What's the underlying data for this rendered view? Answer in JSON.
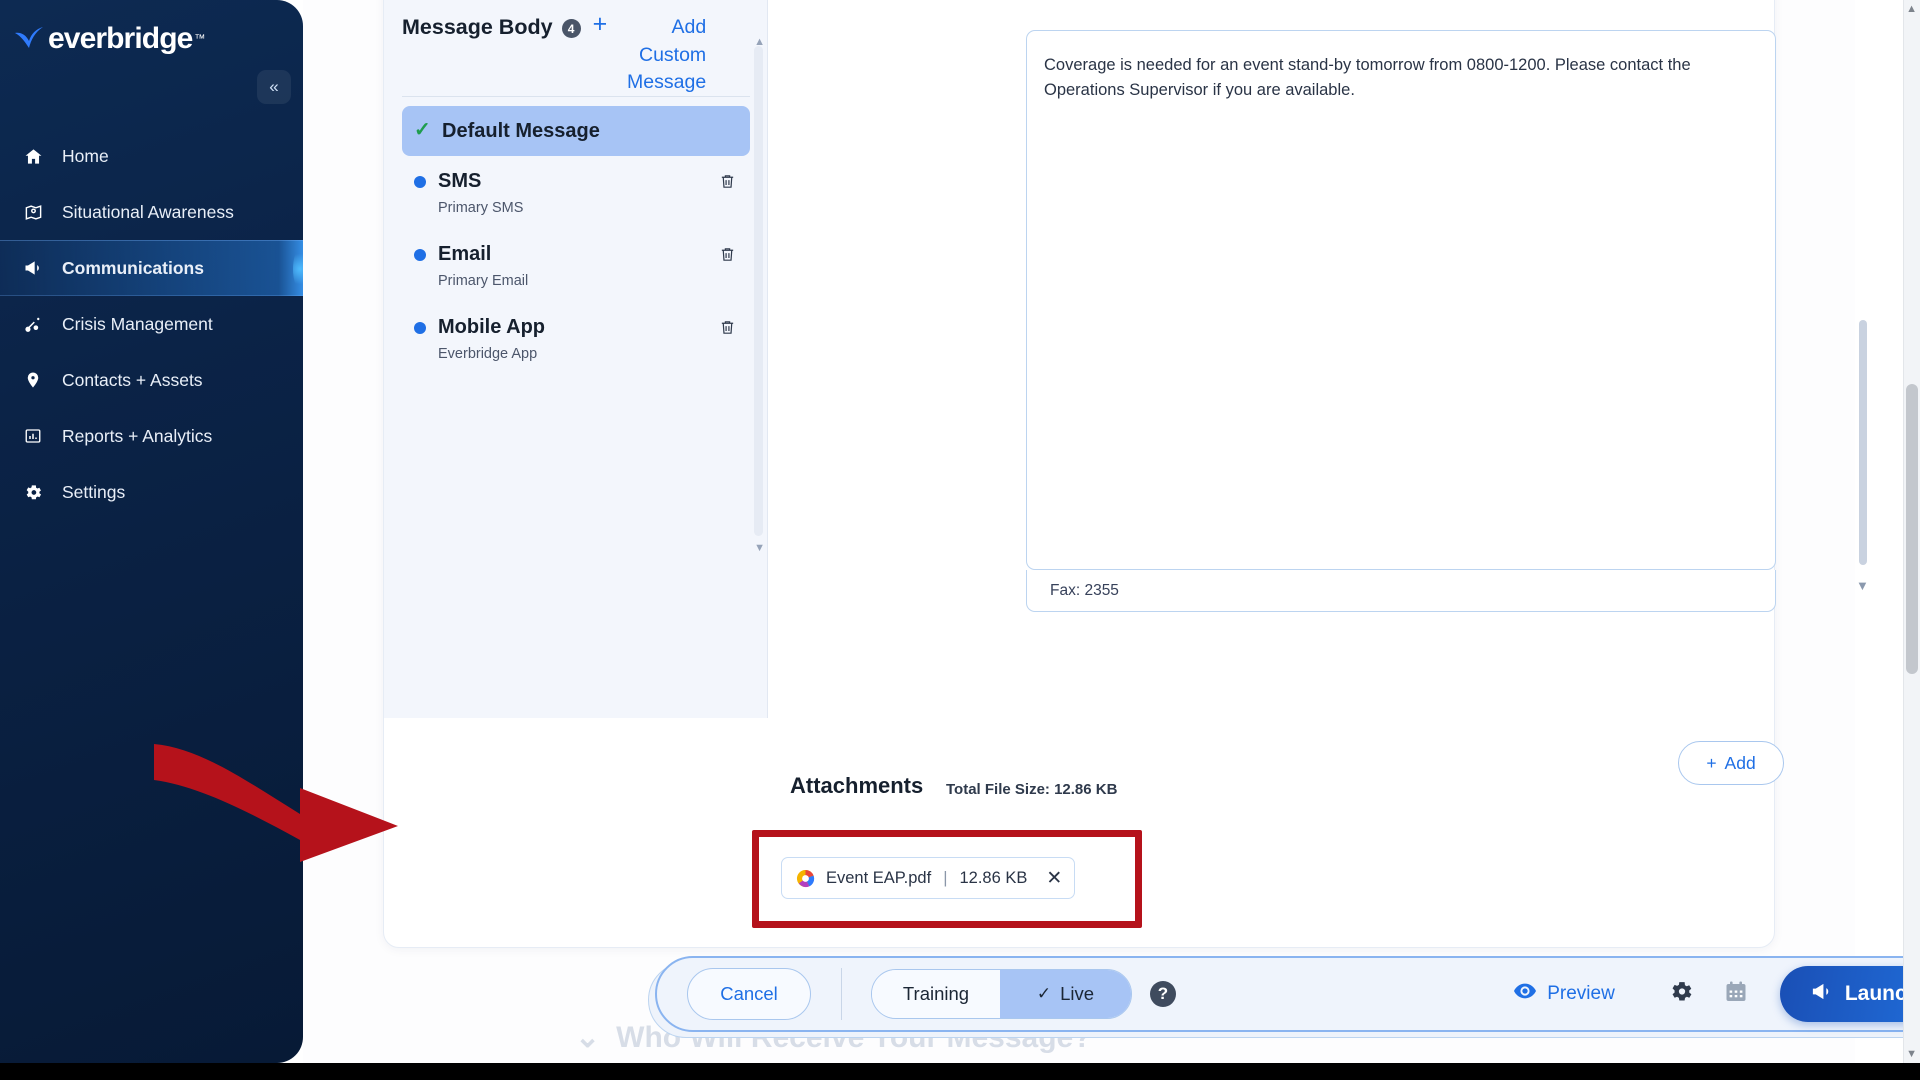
{
  "app": {
    "brand": "everbridge",
    "brand_tm": "™",
    "collapse_icon": "chevron-double-left"
  },
  "sidebar": {
    "items": [
      {
        "label": "Home",
        "icon": "home-icon",
        "active": false
      },
      {
        "label": "Situational Awareness",
        "icon": "map-pin-icon",
        "active": false
      },
      {
        "label": "Communications",
        "icon": "megaphone-icon",
        "active": true
      },
      {
        "label": "Crisis Management",
        "icon": "network-nodes-icon",
        "active": false
      },
      {
        "label": "Contacts + Assets",
        "icon": "location-pin-icon",
        "active": false
      },
      {
        "label": "Reports + Analytics",
        "icon": "bar-chart-icon",
        "active": false
      },
      {
        "label": "Settings",
        "icon": "gear-icon",
        "active": false
      }
    ]
  },
  "message_body": {
    "title": "Message Body",
    "count": "4",
    "add_plus": "+",
    "add_label": "Add Custom Message",
    "items": [
      {
        "name": "Default Message",
        "sub": "",
        "selected": true,
        "marker": "check",
        "deletable": false
      },
      {
        "name": "SMS",
        "sub": "Primary SMS",
        "selected": false,
        "marker": "bullet",
        "deletable": true
      },
      {
        "name": "Email",
        "sub": "Primary Email",
        "selected": false,
        "marker": "bullet",
        "deletable": true
      },
      {
        "name": "Mobile App",
        "sub": "Everbridge App",
        "selected": false,
        "marker": "bullet",
        "deletable": true
      }
    ]
  },
  "editor": {
    "body_text": "Coverage is needed for an event stand-by tomorrow from 0800-1200. Please contact the Operations Supervisor if you are available.",
    "fax_label": "Fax: 2355"
  },
  "attachments": {
    "title": "Attachments",
    "total_size": "Total File Size: 12.86 KB",
    "add_button": "Add",
    "add_plus": "+",
    "files": [
      {
        "name": "Event EAP.pdf",
        "separator": "|",
        "size": "12.86 KB",
        "close_icon": "close-icon",
        "file_icon": "pdf-ring-icon"
      }
    ]
  },
  "ghost_heading": {
    "chevron": "chevron-down-icon",
    "text": "Who Will Receive Your Message?"
  },
  "toolbar": {
    "cancel": "Cancel",
    "mode_training": "Training",
    "mode_live": "Live",
    "live_check": "check-icon",
    "help": "?",
    "preview": "Preview",
    "preview_icon": "eye-icon",
    "settings_icon": "gear-icon",
    "schedule_icon": "calendar-icon",
    "launch": "Launch Communication",
    "launch_icon": "megaphone-icon"
  },
  "colors": {
    "accent_blue": "#1f6fe5",
    "sidebar_dark": "#0b2347",
    "selected_blue": "#a7c4f5",
    "annotation_red": "#b5121b",
    "check_green": "#1f9d4e"
  }
}
